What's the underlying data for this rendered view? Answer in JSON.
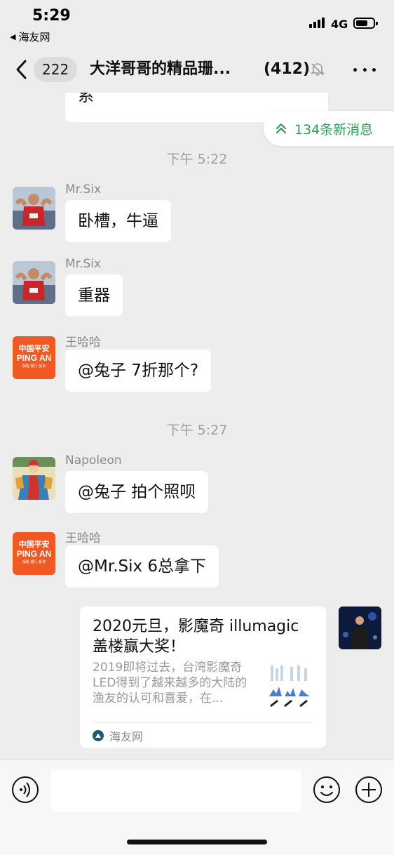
{
  "status_bar": {
    "time": "5:29",
    "back_app": "海友网",
    "network": "4G"
  },
  "nav": {
    "unread_count": "222",
    "title": "大洋哥哥的精品珊...",
    "member_count": "(412)"
  },
  "new_messages_label": "134条新消息",
  "messages": [
    {
      "type": "text",
      "partial": true,
      "text": "系"
    },
    {
      "type": "time",
      "text": "下午 5:22"
    },
    {
      "type": "text",
      "sender": "Mr.Six",
      "avatar": "mrsix-avatar",
      "text": "卧槽，牛逼"
    },
    {
      "type": "text",
      "sender": "Mr.Six",
      "avatar": "mrsix-avatar",
      "text": "重器"
    },
    {
      "type": "text",
      "sender": "王哈哈",
      "avatar": "pingan-avatar",
      "text": "@兔子 7折那个?"
    },
    {
      "type": "time",
      "text": "下午 5:27"
    },
    {
      "type": "text",
      "sender": "Napoleon",
      "avatar": "napoleon-avatar",
      "text": "@兔子 拍个照呗"
    },
    {
      "type": "text",
      "sender": "王哈哈",
      "avatar": "pingan-avatar",
      "text": "@Mr.Six 6总拿下"
    }
  ],
  "pingan_logo": {
    "line1": "中国平安",
    "line2": "PING AN",
    "line3": "保险·银行·投资"
  },
  "link_card": {
    "title": "2020元旦，影魔奇 illumagic 盖楼赢大奖！",
    "description": "2019即将过去，台湾影魔奇LED得到了越来越多的大陆的渔友的认可和喜爱，在...",
    "source": "海友网"
  },
  "input": {
    "placeholder": ""
  },
  "colors": {
    "background": "#ededed",
    "accent_green": "#2d9e5a",
    "pingan_orange": "#f05a22",
    "bubble": "#ffffff"
  }
}
